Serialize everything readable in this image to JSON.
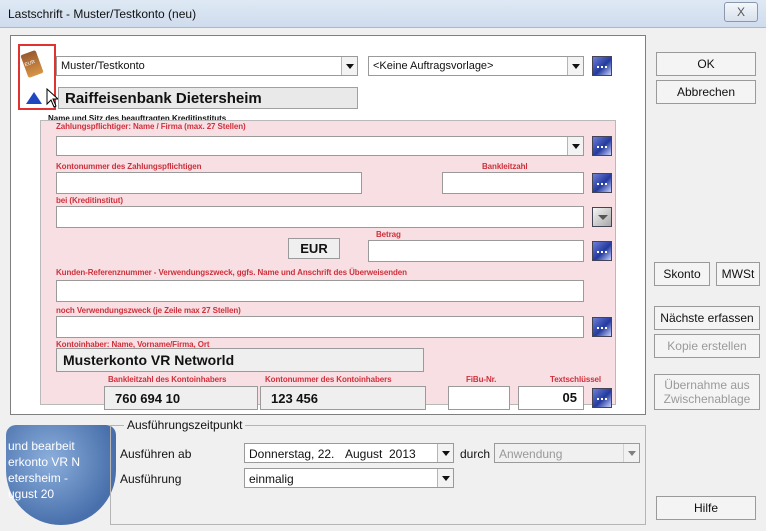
{
  "window": {
    "title": "Lastschrift - Muster/Testkonto (neu)",
    "close_label": "X"
  },
  "account": {
    "selected": "Muster/Testkonto",
    "template": "<Keine Auftragsvorlage>",
    "bank_name": "Raiffeisenbank Dietersheim",
    "bank_caption": "Name und Sitz des beauftragten Kreditinstituts"
  },
  "labels": {
    "payer": "Zahlungspflichtiger: Name / Firma (max. 27 Stellen)",
    "kontonummer": "Kontonummer des Zahlungspflichtigen",
    "bankleitzahl": "Bankleitzahl",
    "bei": "bei (Kreditinstitut)",
    "betrag": "Betrag",
    "kundenref": "Kunden-Referenznummer - Verwendungszweck, ggfs. Name und Anschrift des Überweisenden",
    "verwendungszweck": "noch Verwendungszweck (je Zeile max 27 Stellen)",
    "kontoinhaber": "Kontoinhaber: Name, Vorname/Firma, Ort",
    "blz_inhaber": "Bankleitzahl des Kontoinhabers",
    "kto_inhaber": "Kontonummer des Kontoinhabers",
    "fibu": "FiBu-Nr.",
    "textschluessel": "Textschlüssel"
  },
  "values": {
    "currency": "EUR",
    "kontoinhaber": "Musterkonto VR Networld",
    "blz": "760 694 10",
    "kontonummer": "123 456",
    "textschluessel": "05"
  },
  "buttons": {
    "ok": "OK",
    "abbrechen": "Abbrechen",
    "skonto": "Skonto",
    "mwst": "MWSt",
    "naechste": "Nächste erfassen",
    "kopie": "Kopie erstellen",
    "uebernahme_line1": "Übernahme aus",
    "uebernahme_line2": "Zwischenablage",
    "hilfe": "Hilfe"
  },
  "execution": {
    "group_title": "Ausführungszeitpunkt",
    "ab_label": "Ausführen ab",
    "date_weekday": "Donnerstag, 22.",
    "date_month": "August",
    "date_year": "2013",
    "durch_label": "durch",
    "durch_value": "Anwendung",
    "art_label": "Ausführung",
    "art_value": "einmalig"
  },
  "background_text": {
    "line1": "und bearbeit",
    "line2": "erkonto VR N",
    "line3": "etersheim -",
    "line4": "ugust 20"
  }
}
